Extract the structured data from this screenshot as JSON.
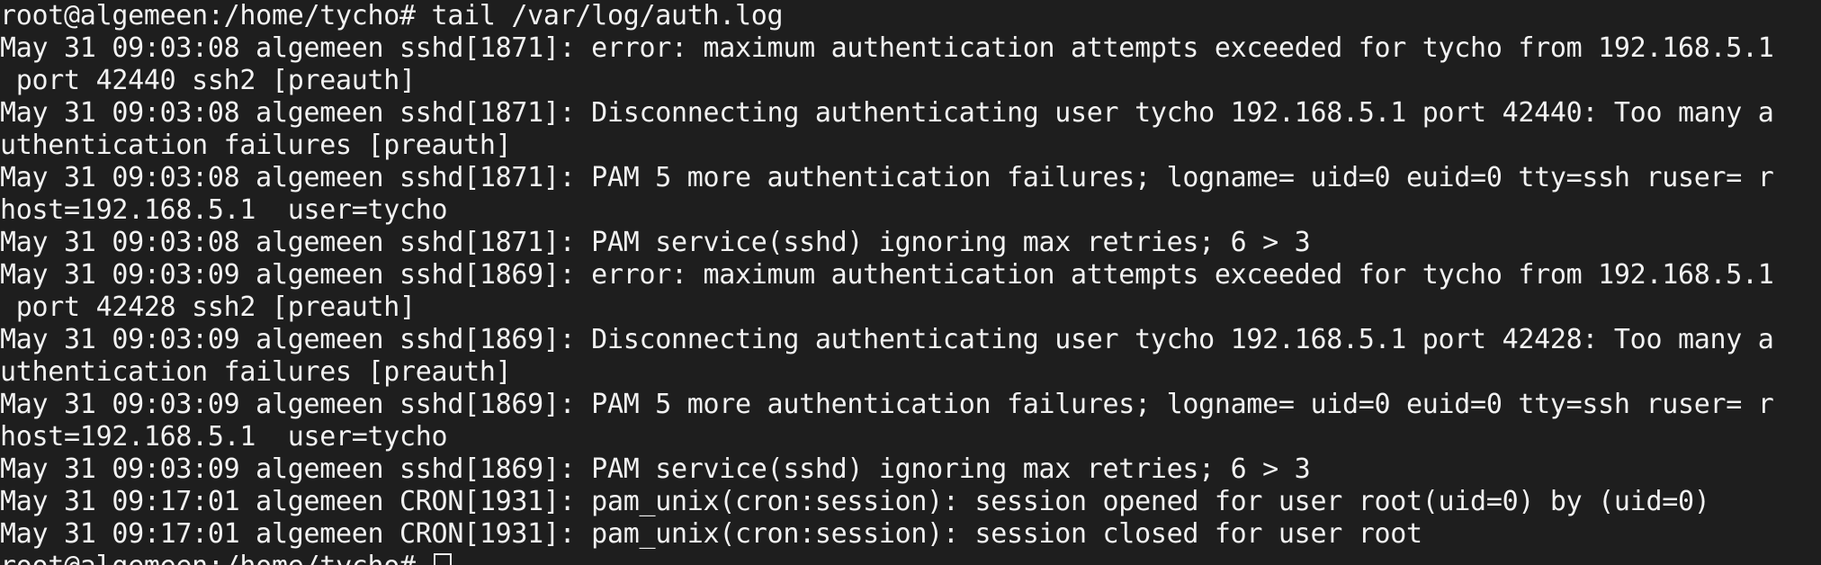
{
  "terminal": {
    "prompt_command": "root@algemeen:/home/tycho# tail /var/log/auth.log",
    "lines": [
      "May 31 09:03:08 algemeen sshd[1871]: error: maximum authentication attempts exceeded for tycho from 192.168.5.1",
      " port 42440 ssh2 [preauth]",
      "May 31 09:03:08 algemeen sshd[1871]: Disconnecting authenticating user tycho 192.168.5.1 port 42440: Too many a",
      "uthentication failures [preauth]",
      "May 31 09:03:08 algemeen sshd[1871]: PAM 5 more authentication failures; logname= uid=0 euid=0 tty=ssh ruser= r",
      "host=192.168.5.1  user=tycho",
      "May 31 09:03:08 algemeen sshd[1871]: PAM service(sshd) ignoring max retries; 6 > 3",
      "May 31 09:03:09 algemeen sshd[1869]: error: maximum authentication attempts exceeded for tycho from 192.168.5.1",
      " port 42428 ssh2 [preauth]",
      "May 31 09:03:09 algemeen sshd[1869]: Disconnecting authenticating user tycho 192.168.5.1 port 42428: Too many a",
      "uthentication failures [preauth]",
      "May 31 09:03:09 algemeen sshd[1869]: PAM 5 more authentication failures; logname= uid=0 euid=0 tty=ssh ruser= r",
      "host=192.168.5.1  user=tycho",
      "May 31 09:03:09 algemeen sshd[1869]: PAM service(sshd) ignoring max retries; 6 > 3",
      "May 31 09:17:01 algemeen CRON[1931]: pam_unix(cron:session): session opened for user root(uid=0) by (uid=0)",
      "May 31 09:17:01 algemeen CRON[1931]: pam_unix(cron:session): session closed for user root"
    ],
    "final_prompt": "root@algemeen:/home/tycho# "
  },
  "colors": {
    "background": "#1e1e1e",
    "foreground": "#f2f2f2"
  }
}
